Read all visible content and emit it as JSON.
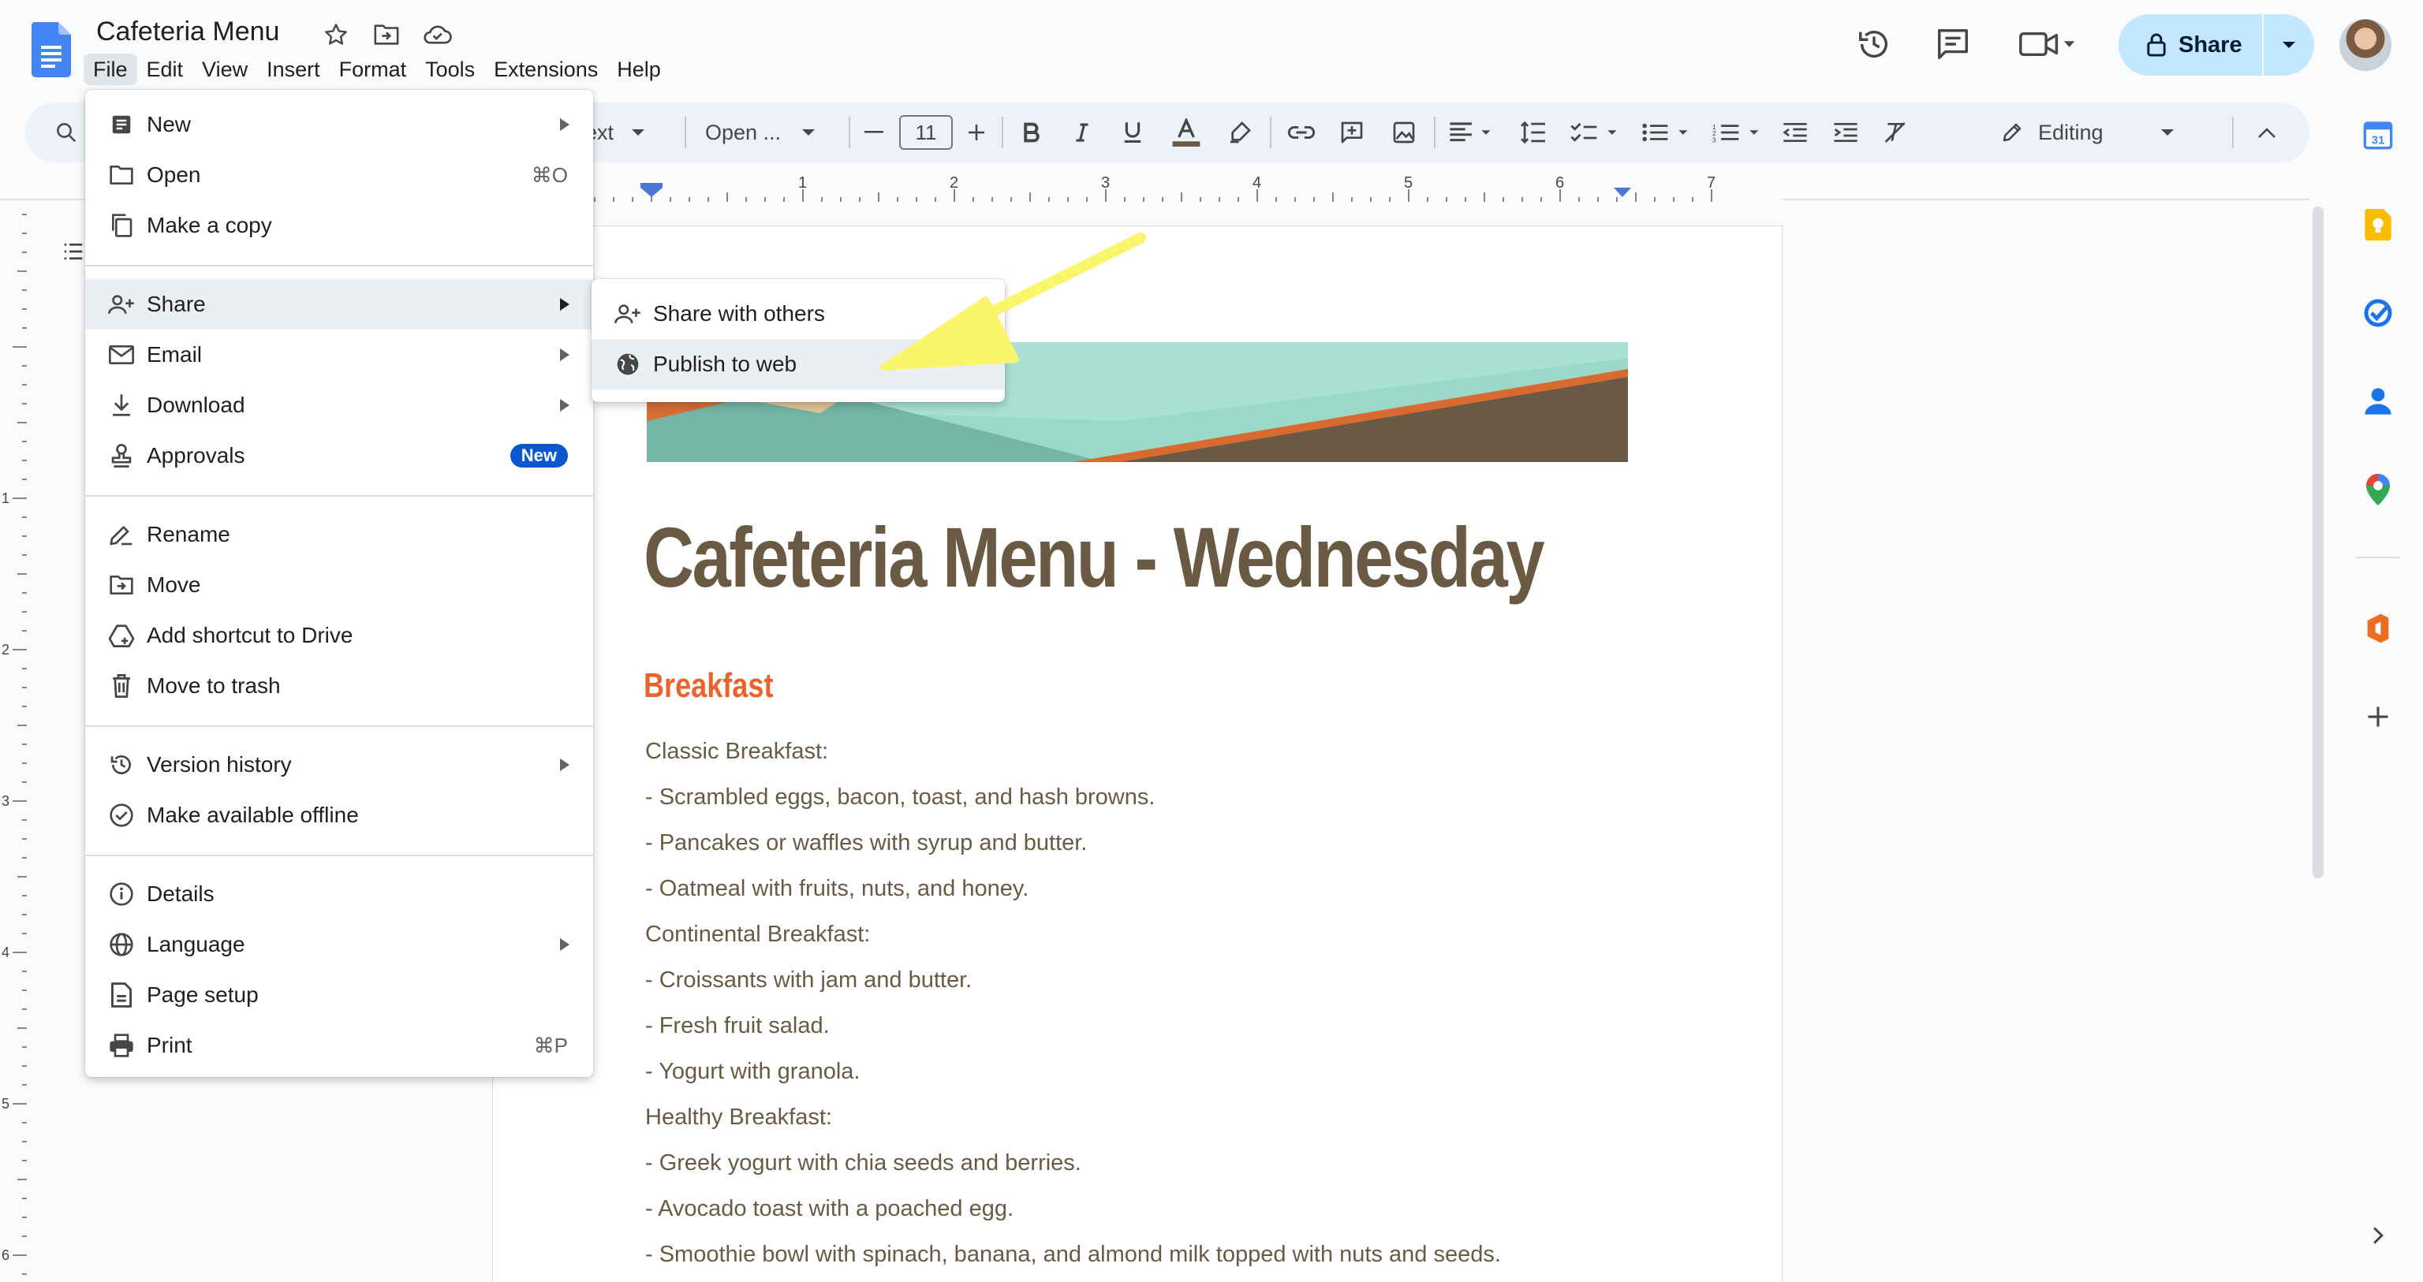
{
  "document": {
    "title": "Cafeteria Menu",
    "heading": "Cafeteria Menu - Wednesday",
    "section_heading": "Breakfast",
    "lines": [
      "Classic Breakfast:",
      "- Scrambled eggs, bacon, toast, and hash browns.",
      "- Pancakes or waffles with syrup and butter.",
      "- Oatmeal with fruits, nuts, and honey.",
      "Continental Breakfast:",
      "- Croissants with jam and butter.",
      "- Fresh fruit salad.",
      "- Yogurt with granola.",
      "Healthy Breakfast:",
      "- Greek yogurt with chia seeds and berries.",
      "- Avocado toast with a poached egg.",
      "- Smoothie bowl with spinach, banana, and almond milk topped with nuts and seeds."
    ]
  },
  "menubar": [
    "File",
    "Edit",
    "View",
    "Insert",
    "Format",
    "Tools",
    "Extensions",
    "Help"
  ],
  "header": {
    "share_label": "Share"
  },
  "toolbar": {
    "style_fragment": "ext",
    "font_name": "Open ...",
    "font_size": "11",
    "mode_label": "Editing"
  },
  "ruler": {
    "h_numbers": [
      "1",
      "2",
      "3",
      "4",
      "5",
      "6",
      "7"
    ],
    "v_numbers": [
      "1",
      "2",
      "3",
      "4",
      "5",
      "6"
    ]
  },
  "file_menu": {
    "new": "New",
    "open": "Open",
    "open_shortcut": "⌘O",
    "make_copy": "Make a copy",
    "share": "Share",
    "email": "Email",
    "download": "Download",
    "approvals": "Approvals",
    "approvals_badge": "New",
    "rename": "Rename",
    "move": "Move",
    "add_shortcut": "Add shortcut to Drive",
    "trash": "Move to trash",
    "version_history": "Version history",
    "offline": "Make available offline",
    "details": "Details",
    "language": "Language",
    "page_setup": "Page setup",
    "print": "Print",
    "print_shortcut": "⌘P"
  },
  "share_submenu": {
    "share_with_others": "Share with others",
    "publish_to_web": "Publish to web"
  },
  "colors": {
    "accent": "#0b57d0",
    "share_button": "#c2e7ff",
    "doc_text": "#6a5a44",
    "doc_subheading": "#e8642c",
    "annotation_arrow": "#faf56a"
  }
}
